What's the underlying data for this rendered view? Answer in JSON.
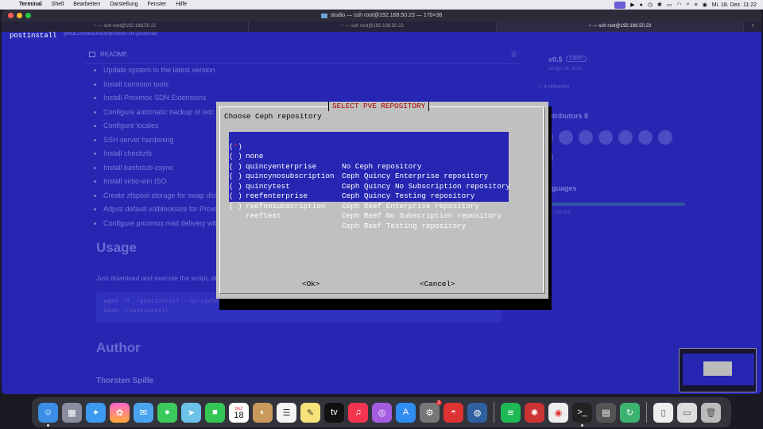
{
  "menubar": {
    "app_name": "Terminal",
    "items": [
      "Shell",
      "Bearbeiten",
      "Darstellung",
      "Fenster",
      "Hilfe"
    ],
    "datetime": "Mi. 18. Dez.  11:22"
  },
  "window": {
    "title": "studio — ssh root@192.168.50.23 — 170×36",
    "tabs": [
      {
        "label": "~ — ssh root@192.168.50.21",
        "active": false
      },
      {
        "label": "~ — ssh root@192.168.50.22",
        "active": false
      },
      {
        "label": "~ — ssh root@192.168.50.23",
        "active": true
      }
    ],
    "new_tab_label": "+"
  },
  "terminal": {
    "prefix_text": "postinstall"
  },
  "background_page": {
    "url": "github.com/bashclub/proxmox-zfs-postinstall",
    "readme_label": "README",
    "list_items": [
      "Update system to the latest version",
      "Install common tools",
      "Install Proxmox SDN Extensions",
      "Configure automatic backup of /etc Folder",
      "Configure locales",
      "SSH server hardening",
      "Install checkzfs",
      "Install bashclub-zsync",
      "Install virtio-win ISO",
      "Create zfspool storage for swap disks if not exists",
      "Adjust default volblocksize for Proxmox zfspool storage",
      "Configure proxmox mail delivery with postfix notifications (pve8)"
    ],
    "usage_heading": "Usage",
    "usage_text": "Just download and execute the script, all settings are made interactively.",
    "code_lines": [
      "wget -O ./postinstall --no-cache https://github.com/bashclub/proxmox-zfs-postinstall/raw/main/postinstall",
      "bash ./postinstall"
    ],
    "author_heading": "Author",
    "author_name": "Thorsten Spille",
    "sidebar": {
      "release_version": "v0.5",
      "release_badge": "Latest",
      "release_date": "on Apr 28, 2022",
      "more_releases": "+ 4 releases",
      "contributors_heading": "Contributors",
      "contributors_count": "8",
      "languages_heading": "Languages",
      "language_entry": "Shell 100.0%"
    }
  },
  "dialog": {
    "title": "SELECT PVE REPOSITORY",
    "prompt": "Choose Ceph repository",
    "options": [
      {
        "radio": "( )",
        "selected": true,
        "name": "none",
        "description": "No Ceph repository"
      },
      {
        "radio": "( )",
        "selected": false,
        "name": "quincyenterprise",
        "description": "Ceph Quincy Enterprise repository"
      },
      {
        "radio": "( )",
        "selected": false,
        "name": "quincynosubscription",
        "description": "Ceph Quincy No Subscription repository"
      },
      {
        "radio": "( )",
        "selected": false,
        "name": "quincytest",
        "description": "Ceph Quincy Testing repository"
      },
      {
        "radio": "( )",
        "selected": false,
        "name": "reefenterprise",
        "description": "Ceph Reef Enterprise repository"
      },
      {
        "radio": "( )",
        "selected": false,
        "name": "reefnosubscription",
        "description": "Ceph Reef No Subscription repository"
      },
      {
        "radio": "( )",
        "selected": false,
        "name": "reeftest",
        "description": "Ceph Reef Testing repository"
      }
    ],
    "selected_mark": "*",
    "ok_label": "<Ok>",
    "cancel_label": "<Cancel>"
  },
  "dock": {
    "calendar_month": "DEZ",
    "calendar_day": "18",
    "badge_count": "1",
    "apps": [
      "finder-icon",
      "launchpad-icon",
      "safari-icon",
      "photos-icon",
      "mail-icon",
      "messages-icon",
      "maps-icon",
      "facetime-icon",
      "calendar-icon",
      "contacts-icon",
      "reminders-icon",
      "notes-icon",
      "appletv-icon",
      "music-icon",
      "podcasts-icon",
      "appstore-icon",
      "settings-icon",
      "vpn-icon",
      "proxy-icon",
      "spotify-icon",
      "app-red-icon",
      "chrome-icon",
      "terminal-icon",
      "calculator-icon",
      "sync-icon",
      "document-icon",
      "folder-icon",
      "trash-icon"
    ]
  },
  "colors": {
    "terminal_blue": "#2626b3",
    "dialog_gray": "#c0c0c0",
    "dialog_title_red": "#b00000",
    "menubar_bg": "#e9e9ee"
  }
}
